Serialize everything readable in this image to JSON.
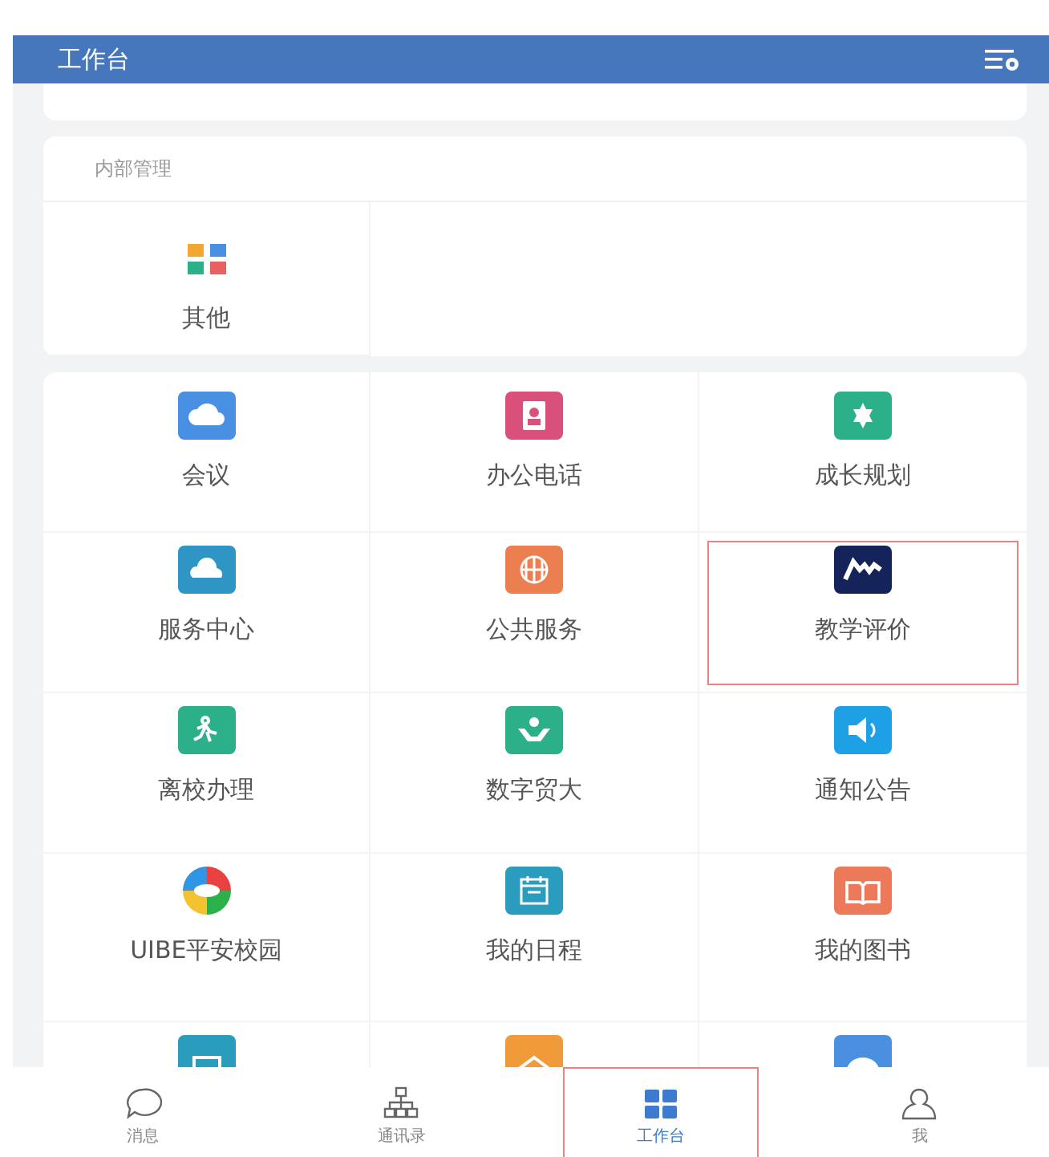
{
  "header": {
    "title": "工作台"
  },
  "sections": [
    {
      "title": "内部管理",
      "items": [
        {
          "label": "其他",
          "highlighted": false
        }
      ]
    },
    {
      "items": [
        {
          "label": "会议",
          "color": "#4a90e2",
          "highlighted": false
        },
        {
          "label": "办公电话",
          "color": "#d9507a",
          "highlighted": false
        },
        {
          "label": "成长规划",
          "color": "#2bb08a",
          "highlighted": false
        },
        {
          "label": "服务中心",
          "color": "#2f95c4",
          "highlighted": false
        },
        {
          "label": "公共服务",
          "color": "#ec7f4f",
          "highlighted": false
        },
        {
          "label": "教学评价",
          "color": "#14245a",
          "highlighted": true
        },
        {
          "label": "离校办理",
          "color": "#2bb08a",
          "highlighted": false
        },
        {
          "label": "数字贸大",
          "color": "#2bb08a",
          "highlighted": false
        },
        {
          "label": "通知公告",
          "color": "#1ea0e6",
          "highlighted": false
        },
        {
          "label": "UIBE平安校园",
          "color": "#e94040",
          "highlighted": false
        },
        {
          "label": "我的日程",
          "color": "#2a9dbf",
          "highlighted": false
        },
        {
          "label": "我的图书",
          "color": "#ec7a5a",
          "highlighted": false
        },
        {
          "color": "#2a9dbf",
          "highlighted": false
        },
        {
          "color": "#f09a3a",
          "highlighted": false
        },
        {
          "color": "#4a8fe0",
          "highlighted": false
        }
      ]
    }
  ],
  "tabbar": [
    {
      "label": "消息",
      "selected": false,
      "highlighted": false
    },
    {
      "label": "通讯录",
      "selected": false,
      "highlighted": false
    },
    {
      "label": "工作台",
      "selected": true,
      "highlighted": true
    },
    {
      "label": "我",
      "selected": false,
      "highlighted": false
    }
  ]
}
